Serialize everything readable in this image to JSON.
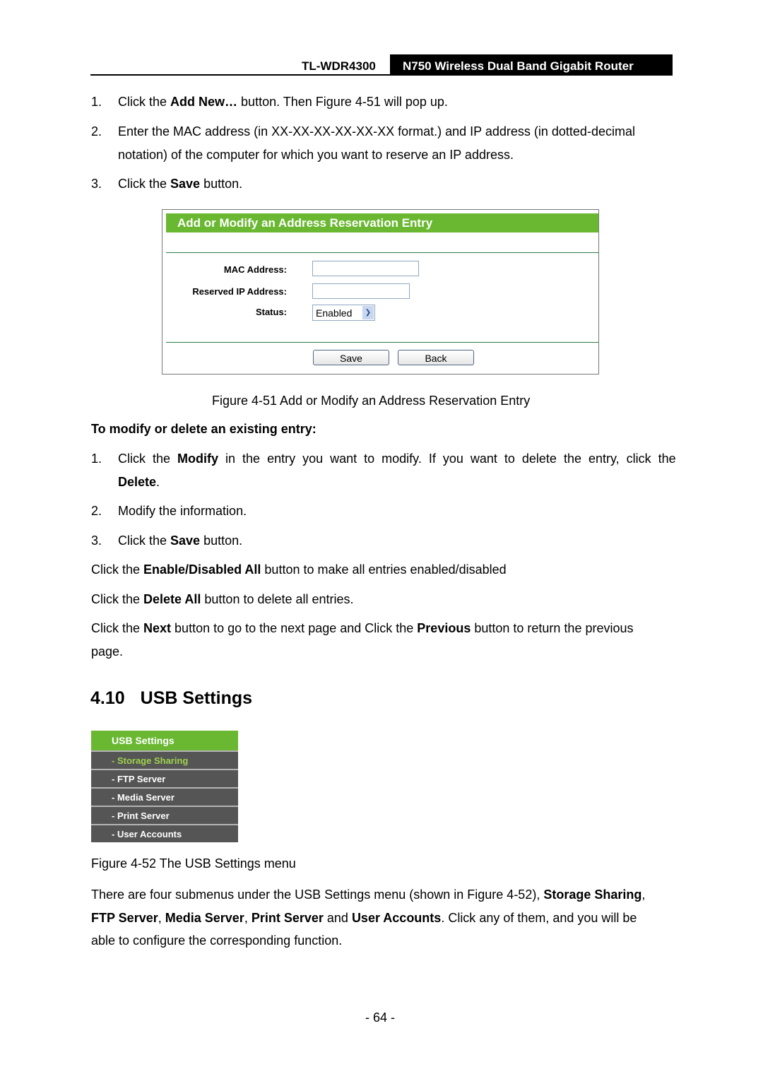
{
  "header": {
    "model": "TL-WDR4300",
    "product": "N750 Wireless Dual Band Gigabit Router"
  },
  "steps_add": [
    {
      "num": "1.",
      "pre": "Click the ",
      "bold": "Add New…",
      "post": " button. Then Figure 4-51 will pop up."
    },
    {
      "num": "2.",
      "line1": "Enter the MAC address (in XX-XX-XX-XX-XX-XX format.) and IP address (in dotted-decimal",
      "line2": "notation) of the computer for which you want to reserve an IP address."
    },
    {
      "num": "3.",
      "pre": "Click the ",
      "bold": "Save",
      "post": " button."
    }
  ],
  "figure_51": {
    "title": "Add or Modify an Address Reservation Entry",
    "mac_label": "MAC Address:",
    "mac_value": "",
    "ip_label": "Reserved IP Address:",
    "ip_value": "",
    "status_label": "Status:",
    "status_value": "Enabled",
    "save_label": "Save",
    "back_label": "Back",
    "caption": "Figure 4-51 Add or Modify an Address Reservation Entry"
  },
  "modify_heading": "To modify or delete an existing entry:",
  "steps_modify": [
    {
      "num": "1.",
      "pre": "Click  the  ",
      "bold": "Modify",
      "post": "  in  the  entry  you  want  to  modify.  If  you  want  to  delete  the  entry,  click  the",
      "line2_bold": "Delete",
      "line2_post": "."
    },
    {
      "num": "2.",
      "text": "Modify the information."
    },
    {
      "num": "3.",
      "pre": "Click the ",
      "bold": "Save",
      "post": " button."
    }
  ],
  "paras": [
    {
      "pre": "Click the ",
      "bold": "Enable/Disabled All",
      "post": " button to make all entries enabled/disabled"
    },
    {
      "pre": "Click the ",
      "bold": "Delete All",
      "post": " button to delete all entries."
    },
    {
      "pre": "Click the ",
      "bold": "Next",
      "mid": " button to go to the next page and Click the ",
      "bold2": "Previous",
      "post": " button to return the previous",
      "line2": "page."
    }
  ],
  "section": {
    "number": "4.10",
    "title": "USB Settings"
  },
  "usb_menu": {
    "header": "USB Settings",
    "items": [
      "- Storage Sharing",
      "- FTP Server",
      "- Media Server",
      "- Print Server",
      "- User Accounts"
    ],
    "active_index": 0,
    "caption": "Figure 4-52 The USB Settings menu"
  },
  "final_para": {
    "l1_pre": "There are four submenus under the USB Settings menu (shown in Figure 4-52), ",
    "l1_b1": "Storage Sharing",
    "l1_post": ",",
    "l2_b1": "FTP Server",
    "l2_s1": ", ",
    "l2_b2": "Media Server",
    "l2_s2": ", ",
    "l2_b3": "Print Server",
    "l2_s3": " and ",
    "l2_b4": "User Accounts",
    "l2_post": ". Click any of them, and you will be",
    "l3": "able to configure the corresponding function."
  },
  "page_number": "- 64 -"
}
